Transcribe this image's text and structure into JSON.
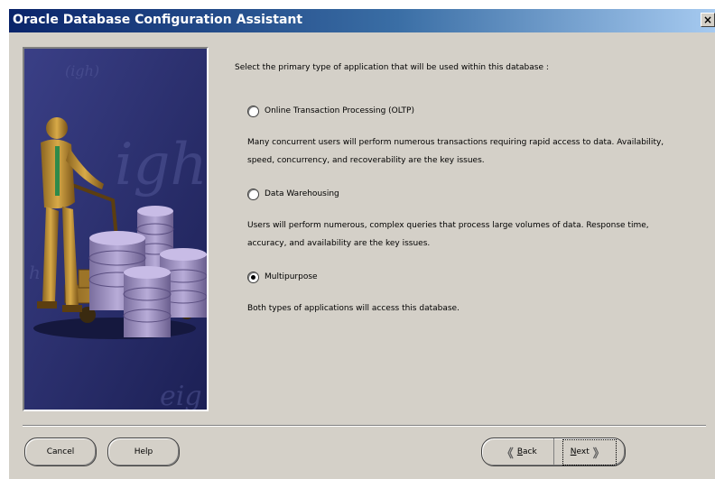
{
  "window": {
    "title": "Oracle Database Configuration Assistant",
    "close_label": "×"
  },
  "content": {
    "prompt": "Select the primary type of application that will be used within this database :",
    "options": [
      {
        "label": "Online Transaction Processing (OLTP)",
        "selected": false,
        "description": "Many concurrent users will perform numerous transactions requiring rapid access to data. Availability, speed, concurrency, and recoverability are the key issues."
      },
      {
        "label": "Data Warehousing",
        "selected": false,
        "description": "Users will perform numerous, complex queries that process large volumes of data. Response time, accuracy, and availability are the key issues."
      },
      {
        "label": "Multipurpose",
        "selected": true,
        "description": "Both types of applications will access this database."
      }
    ]
  },
  "buttons": {
    "cancel": "Cancel",
    "help": "Help",
    "back": "Back",
    "next": "Next"
  },
  "colors": {
    "title_start": "#0a246a",
    "title_end": "#a6caf0",
    "dialog_bg": "#d4d0c8",
    "art_bg": "#2a2f6e",
    "figure": "#c89a3a",
    "disk": "#9c8fc0"
  }
}
